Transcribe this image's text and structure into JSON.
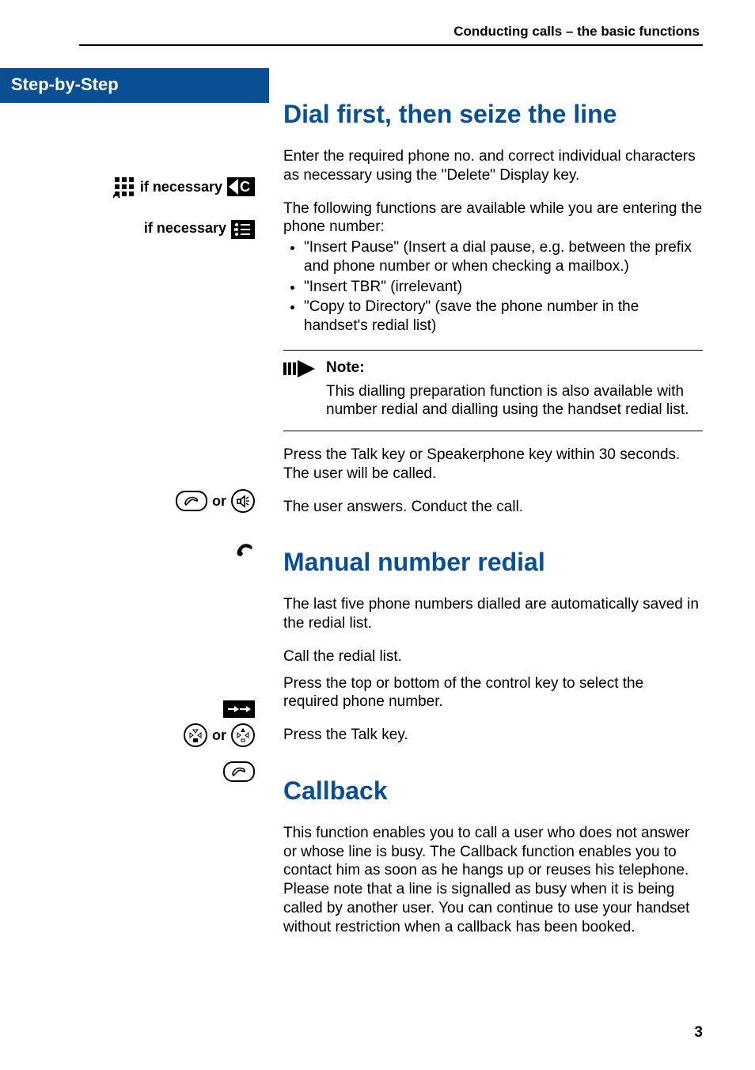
{
  "header": {
    "running_head": "Conducting calls – the basic functions"
  },
  "side": {
    "title": "Step-by-Step",
    "if_necessary": "if necessary",
    "or": "or"
  },
  "icons": {
    "keypad": "keypad-icon",
    "delete_c": "C",
    "menu": "menu-key-icon",
    "talk": "talk-key-icon",
    "speaker": "speakerphone-key-icon",
    "handset": "handset-icon",
    "redial": "redial-key-icon",
    "nav_down": "control-key-down-icon",
    "nav_up": "control-key-up-icon",
    "note_arrow": "note-arrow-icon"
  },
  "section1": {
    "title": "Dial first, then seize the line",
    "p1": "Enter the required phone no. and correct individual characters as necessary using the \"Delete\" Display key.",
    "p2_intro": "The following functions are available while you are entering the phone number:",
    "bullets": [
      "\"Insert Pause\" (Insert a dial pause, e.g.  between the prefix and phone number or when checking a mailbox.)",
      "\"Insert TBR\" (irrelevant)",
      "\"Copy to Directory\" (save the phone number in the handset's redial list)"
    ],
    "note_title": "Note:",
    "note_body": "This dialling preparation function is also available with number redial and dialling using the handset redial list.",
    "p3": "Press the Talk key or Speakerphone key within 30 seconds. The user will be called.",
    "p4": "The user answers. Conduct the call."
  },
  "section2": {
    "title": "Manual number redial",
    "p1": "The last five phone numbers dialled are automatically saved in the redial list.",
    "p2": "Call the redial list.",
    "p3": "Press the top or bottom of the control key to select the required phone number.",
    "p4": "Press the Talk key."
  },
  "section3": {
    "title": "Callback",
    "p1": "This function enables you to call a user who does not answer or whose line is busy. The Callback function enables you to contact him as soon as he hangs up or reuses his telephone. Please note that a line is signalled as busy when it is being called by another user. You can continue to use your handset without restriction when a callback has been booked."
  },
  "page_number": "3"
}
